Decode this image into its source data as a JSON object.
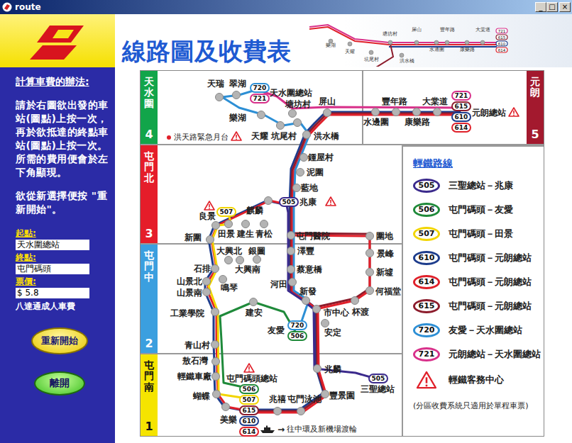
{
  "window": {
    "title": "route",
    "controls": [
      "_",
      "□",
      "×"
    ]
  },
  "sidebar": {
    "heading": "計算車費的辦法:",
    "instructions": "請於右圖欲出發的車站(圖點)上按一次，再於欲抵達的終點車站(圖點)上按一次。所需的費用便會於左下角顯現。",
    "reset_hint": "欲從新選擇便按 \"重新開始\"。",
    "fields": [
      {
        "label": "起點:",
        "value": "天水圍總站"
      },
      {
        "label": "終點:",
        "value": "屯門碼頭"
      },
      {
        "label": "票價:",
        "value": "$ 5.8"
      }
    ],
    "fare_note": "八達通成人車費",
    "buttons": [
      {
        "label": "重新開始",
        "kind": "reset"
      },
      {
        "label": "離開",
        "kind": "exit"
      }
    ]
  },
  "header": {
    "title": "線路圖及收費表",
    "minimap_labels": [
      "樂湖",
      "天耀",
      "坑尾村",
      "塘坊村",
      "屏山",
      "洪水橋",
      "水邊圍",
      "豐年路",
      "康樂路",
      "大棠道"
    ],
    "minimap_badges": [
      "721",
      "615",
      "610",
      "614"
    ]
  },
  "map": {
    "zones": [
      {
        "name": "天水圍",
        "number": "4",
        "kind": "left",
        "color": "#12a54a"
      },
      {
        "name": "元朗",
        "number": "5",
        "kind": "right",
        "color": "#a3192e"
      },
      {
        "name": "屯門北",
        "number": "3",
        "kind": "left",
        "color": "#e51d2a"
      },
      {
        "name": "屯門中",
        "number": "2",
        "kind": "left",
        "color": "#3b9fdf"
      },
      {
        "name": "屯門南",
        "number": "1",
        "kind": "left",
        "color": "#f5e400"
      }
    ],
    "emergency_platform": "洪天路緊急月台",
    "stations": [
      {
        "name": "天瑞",
        "kind": "stop",
        "badges": [],
        "service_centre": false
      },
      {
        "name": "翠湖",
        "kind": "stop",
        "badges": [],
        "service_centre": false
      },
      {
        "name": "天水圍總站",
        "kind": "terminal",
        "badges": [
          "720",
          "721"
        ],
        "service_centre": false
      },
      {
        "name": "樂湖",
        "kind": "stop",
        "badges": [],
        "service_centre": false
      },
      {
        "name": "天耀",
        "kind": "stop",
        "badges": [],
        "service_centre": true
      },
      {
        "name": "坑尾村",
        "kind": "stop",
        "badges": [],
        "service_centre": false
      },
      {
        "name": "塘坊村",
        "kind": "stop",
        "badges": [],
        "service_centre": false
      },
      {
        "name": "屏山",
        "kind": "stop",
        "badges": [],
        "service_centre": false
      },
      {
        "name": "洪水橋",
        "kind": "stop",
        "badges": [],
        "service_centre": false
      },
      {
        "name": "水邊圍",
        "kind": "stop",
        "badges": [],
        "service_centre": false
      },
      {
        "name": "豐年路",
        "kind": "stop",
        "badges": [],
        "service_centre": false
      },
      {
        "name": "康樂路",
        "kind": "stop",
        "badges": [],
        "service_centre": false
      },
      {
        "name": "大棠道",
        "kind": "stop",
        "badges": [],
        "service_centre": false
      },
      {
        "name": "元朗總站",
        "kind": "terminal",
        "badges": [
          "721",
          "615",
          "610",
          "614"
        ],
        "service_centre": true
      },
      {
        "name": "鍾屋村",
        "kind": "stop",
        "badges": [],
        "service_centre": false
      },
      {
        "name": "泥圍",
        "kind": "stop",
        "badges": [],
        "service_centre": false
      },
      {
        "name": "藍地",
        "kind": "stop",
        "badges": [],
        "service_centre": false
      },
      {
        "name": "兆康",
        "kind": "terminal",
        "badges": [
          "505"
        ],
        "service_centre": true
      },
      {
        "name": "麒麟",
        "kind": "stop",
        "badges": [],
        "service_centre": false
      },
      {
        "name": "良景",
        "kind": "stop",
        "badges": [],
        "service_centre": true
      },
      {
        "name": "新圍",
        "kind": "stop",
        "badges": [],
        "service_centre": false
      },
      {
        "name": "田景",
        "kind": "stop",
        "badges": [
          "507"
        ],
        "service_centre": false
      },
      {
        "name": "建生",
        "kind": "stop",
        "badges": [],
        "service_centre": false
      },
      {
        "name": "青松",
        "kind": "stop",
        "badges": [],
        "service_centre": false
      },
      {
        "name": "屯門醫院",
        "kind": "stop",
        "badges": [],
        "service_centre": false
      },
      {
        "name": "圍地",
        "kind": "stop",
        "badges": [],
        "service_centre": false
      },
      {
        "name": "大興北",
        "kind": "stop",
        "badges": [],
        "service_centre": false
      },
      {
        "name": "銀圖",
        "kind": "stop",
        "badges": [],
        "service_centre": false
      },
      {
        "name": "澤豐",
        "kind": "stop",
        "badges": [],
        "service_centre": false
      },
      {
        "name": "景峰",
        "kind": "stop",
        "badges": [],
        "service_centre": false
      },
      {
        "name": "石排",
        "kind": "stop",
        "badges": [],
        "service_centre": false
      },
      {
        "name": "大興南",
        "kind": "stop",
        "badges": [],
        "service_centre": false
      },
      {
        "name": "蔡意橋",
        "kind": "stop",
        "badges": [],
        "service_centre": false
      },
      {
        "name": "新墟",
        "kind": "stop",
        "badges": [],
        "service_centre": false
      },
      {
        "name": "山景北",
        "kind": "stop",
        "badges": [],
        "service_centre": false
      },
      {
        "name": "山景南",
        "kind": "stop",
        "badges": [],
        "service_centre": false
      },
      {
        "name": "鳴琴",
        "kind": "stop",
        "badges": [],
        "service_centre": false
      },
      {
        "name": "河田",
        "kind": "stop",
        "badges": [],
        "service_centre": false
      },
      {
        "name": "新發",
        "kind": "stop",
        "badges": [],
        "service_centre": false
      },
      {
        "name": "何福堂",
        "kind": "stop",
        "badges": [],
        "service_centre": false
      },
      {
        "name": "工業學院",
        "kind": "stop",
        "badges": [],
        "service_centre": false
      },
      {
        "name": "建安",
        "kind": "stop",
        "badges": [],
        "service_centre": false
      },
      {
        "name": "市中心",
        "kind": "stop",
        "badges": [],
        "service_centre": false
      },
      {
        "name": "杯渡",
        "kind": "stop",
        "badges": [],
        "service_centre": false
      },
      {
        "name": "友愛",
        "kind": "terminal",
        "badges": [
          "720",
          "506"
        ],
        "service_centre": false
      },
      {
        "name": "安定",
        "kind": "stop",
        "badges": [],
        "service_centre": false
      },
      {
        "name": "青山村",
        "kind": "stop",
        "badges": [],
        "service_centre": false
      },
      {
        "name": "兆麟",
        "kind": "stop",
        "badges": [],
        "service_centre": false
      },
      {
        "name": "敖石灣",
        "kind": "stop",
        "badges": [],
        "service_centre": false
      },
      {
        "name": "輕鐵車廠",
        "kind": "stop",
        "badges": [],
        "service_centre": false
      },
      {
        "name": "屯門碼頭總站",
        "kind": "terminal",
        "badges": [
          "506",
          "507",
          "615",
          "610",
          "614"
        ],
        "service_centre": true
      },
      {
        "name": "蝴蝶",
        "kind": "stop",
        "badges": [],
        "service_centre": false
      },
      {
        "name": "美樂",
        "kind": "stop",
        "badges": [],
        "service_centre": false
      },
      {
        "name": "兆禧",
        "kind": "stop",
        "badges": [],
        "service_centre": false
      },
      {
        "name": "屯門泳池",
        "kind": "stop",
        "badges": [],
        "service_centre": false
      },
      {
        "name": "豐景園",
        "kind": "stop",
        "badges": [],
        "service_centre": false
      },
      {
        "name": "三聖總站",
        "kind": "terminal",
        "badges": [
          "505"
        ],
        "service_centre": false
      }
    ],
    "ferry": {
      "arrow": "→",
      "label": "往中環及新機場渡輪"
    }
  },
  "legend": {
    "title": "輕鐵路線",
    "routes": [
      {
        "number": "505",
        "name": "三聖總站－兆康",
        "color": "#3b2a8c"
      },
      {
        "number": "506",
        "name": "屯門碼頭－友愛",
        "color": "#1f8a3a"
      },
      {
        "number": "507",
        "name": "屯門碼頭－田景",
        "color": "#f2d500"
      },
      {
        "number": "610",
        "name": "屯門碼頭－元朗總站",
        "color": "#1d3c8c"
      },
      {
        "number": "614",
        "name": "屯門碼頭－元朗總站",
        "color": "#e0202a"
      },
      {
        "number": "615",
        "name": "屯門碼頭－元朗總站",
        "color": "#8c1c2c"
      },
      {
        "number": "720",
        "name": "友愛－天水圍總站",
        "color": "#2d8fd5"
      },
      {
        "number": "721",
        "name": "元朗總站－天水圍總站",
        "color": "#d8308a"
      }
    ],
    "service_centre": "輕鐵客務中心",
    "note": "(分區收費系統只適用於單程車票)"
  }
}
